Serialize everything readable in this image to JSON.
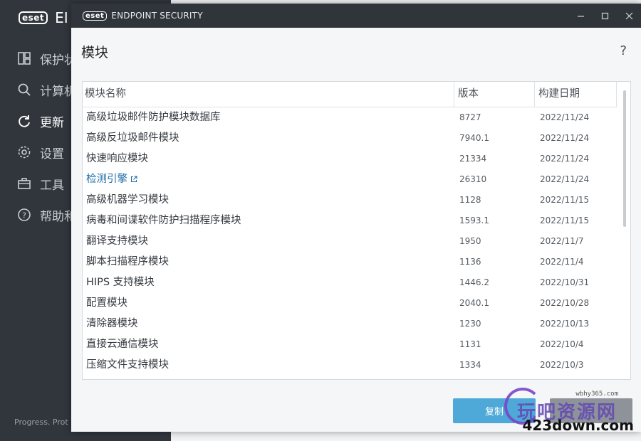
{
  "background": {
    "logo_badge": "eset",
    "logo_text": "EI",
    "nav": [
      {
        "label": "保护状",
        "icon": "dashboard-icon"
      },
      {
        "label": "计算机",
        "icon": "search-icon"
      },
      {
        "label": "更新",
        "icon": "refresh-icon",
        "active": true
      },
      {
        "label": "设置",
        "icon": "gear-icon"
      },
      {
        "label": "工具",
        "icon": "briefcase-icon"
      },
      {
        "label": "帮助和",
        "icon": "help-circle-icon"
      }
    ],
    "footer": "Progress. Prot"
  },
  "dialog": {
    "app_badge": "eset",
    "app_title": "ENDPOINT SECURITY",
    "title": "模块",
    "help": "?",
    "columns": {
      "name": "模块名称",
      "version": "版本",
      "date": "构建日期"
    },
    "rows": [
      {
        "name": "高级垃圾邮件防护模块数据库",
        "version": "8727",
        "date": "2022/11/24"
      },
      {
        "name": "高级反垃圾邮件模块",
        "version": "7940.1",
        "date": "2022/11/24"
      },
      {
        "name": "快速响应模块",
        "version": "21334",
        "date": "2022/11/24"
      },
      {
        "name": "检测引擎",
        "version": "26310",
        "date": "2022/11/24",
        "link": true
      },
      {
        "name": "高级机器学习模块",
        "version": "1128",
        "date": "2022/11/15"
      },
      {
        "name": "病毒和间谍软件防护扫描程序模块",
        "version": "1593.1",
        "date": "2022/11/15"
      },
      {
        "name": "翻译支持模块",
        "version": "1950",
        "date": "2022/11/7"
      },
      {
        "name": "脚本扫描程序模块",
        "version": "1136",
        "date": "2022/11/4"
      },
      {
        "name": "HIPS 支持模块",
        "version": "1446.2",
        "date": "2022/10/31"
      },
      {
        "name": "配置模块",
        "version": "2040.1",
        "date": "2022/10/28"
      },
      {
        "name": "清除器模块",
        "version": "1230",
        "date": "2022/10/13"
      },
      {
        "name": "直接云通信模块",
        "version": "1131",
        "date": "2022/10/4"
      },
      {
        "name": "压缩文件支持模块",
        "version": "1334",
        "date": "2022/10/3"
      }
    ],
    "copy_label": "复制"
  },
  "watermark": {
    "site": "wbhy365.com",
    "text": "玩吧资源网",
    "domain": "423down.com"
  },
  "colors": {
    "accent": "#4fa9d8",
    "link": "#1f6fa8",
    "titlebar": "#2f353b"
  }
}
